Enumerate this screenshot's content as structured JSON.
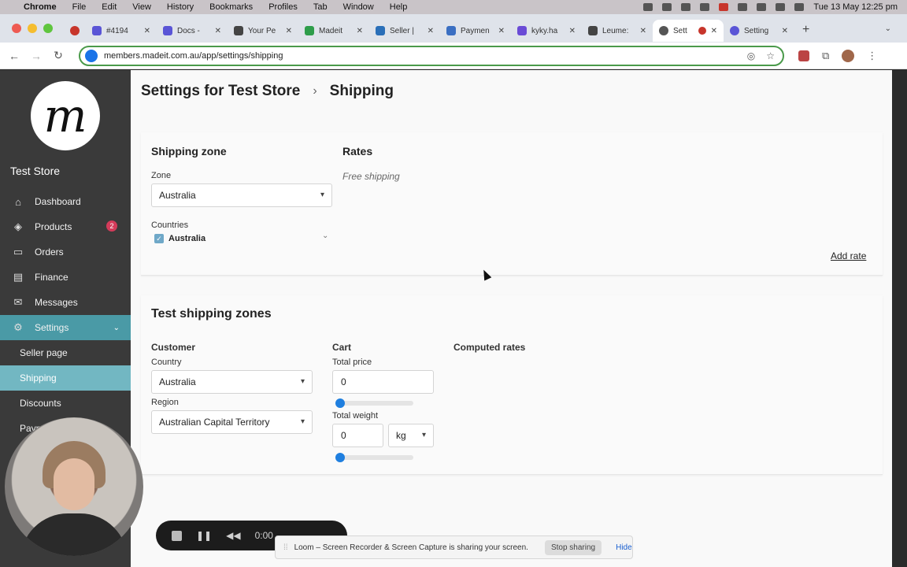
{
  "menubar": {
    "app": "Chrome",
    "items": [
      "File",
      "Edit",
      "View",
      "History",
      "Bookmarks",
      "Profiles",
      "Tab",
      "Window",
      "Help"
    ],
    "datetime": "Tue 13 May  12:25 pm"
  },
  "tabs": [
    {
      "label": "",
      "icon": "record-icon",
      "color": "#c7352b"
    },
    {
      "label": "#4194",
      "icon": "linear-icon",
      "color": "#5a55d6"
    },
    {
      "label": "Docs -",
      "icon": "linear-icon",
      "color": "#5a55d6"
    },
    {
      "label": "Your Pe",
      "icon": "madeit-icon",
      "color": "#444444"
    },
    {
      "label": "Madeit",
      "icon": "evernote-icon",
      "color": "#2e9d4a"
    },
    {
      "label": "Seller |",
      "icon": "seller-icon",
      "color": "#2a6fb8"
    },
    {
      "label": "Paymen",
      "icon": "doc-icon",
      "color": "#3b6fc2"
    },
    {
      "label": "kyky.ha",
      "icon": "stripe-icon",
      "color": "#6a4bd6"
    },
    {
      "label": "Leume:",
      "icon": "madeit-icon",
      "color": "#444444"
    },
    {
      "label": "Sett",
      "icon": "globe-icon",
      "color": "#555555",
      "active": true
    },
    {
      "label": "Setting",
      "icon": "gear-icon",
      "color": "#5a55d6"
    }
  ],
  "address": {
    "url": "members.madeit.com.au/app/settings/shipping"
  },
  "sidebar": {
    "store_name": "Test Store",
    "items": [
      {
        "label": "Dashboard",
        "icon": "home-icon"
      },
      {
        "label": "Products",
        "icon": "layers-icon",
        "badge": "2"
      },
      {
        "label": "Orders",
        "icon": "book-icon"
      },
      {
        "label": "Finance",
        "icon": "card-icon"
      },
      {
        "label": "Messages",
        "icon": "mail-icon"
      },
      {
        "label": "Settings",
        "icon": "gear-icon"
      }
    ],
    "subitems": [
      {
        "label": "Seller page"
      },
      {
        "label": "Shipping"
      },
      {
        "label": "Discounts"
      },
      {
        "label": "Paym"
      }
    ]
  },
  "page": {
    "title": "Settings for Test Store",
    "current": "Shipping"
  },
  "zone": {
    "heading": "Shipping zone",
    "zone_label": "Zone",
    "zone_value": "Australia",
    "countries_label": "Countries",
    "country_checked": "Australia",
    "rates_heading": "Rates",
    "rate_free": "Free shipping",
    "add_rate": "Add rate"
  },
  "test": {
    "heading": "Test shipping zones",
    "customer_label": "Customer",
    "country_label": "Country",
    "country_value": "Australia",
    "region_label": "Region",
    "region_value": "Australian Capital Territory",
    "cart_label": "Cart",
    "total_price_label": "Total price",
    "total_price_value": "0",
    "total_weight_label": "Total weight",
    "total_weight_value": "0",
    "weight_unit": "kg",
    "computed_label": "Computed rates"
  },
  "recorder": {
    "time": "0:00"
  },
  "sharebar": {
    "message": "Loom – Screen Recorder & Screen Capture is sharing your screen.",
    "stop": "Stop sharing",
    "hide": "Hide"
  }
}
